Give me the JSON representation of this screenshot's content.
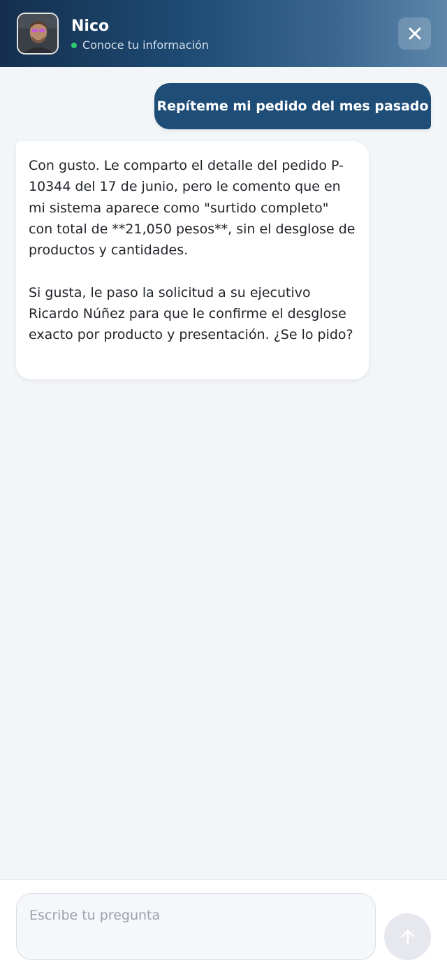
{
  "header": {
    "agent_name": "Nico",
    "status_text": "Conoce tu información",
    "status_color": "#2ecc71",
    "close_icon": "close-icon"
  },
  "messages": [
    {
      "role": "user",
      "text": "Repíteme mi pedido del mes pasado"
    },
    {
      "role": "assistant",
      "text": "Con gusto. Le comparto el detalle del pedido P-10344 del 17 de junio, pero le comento que en mi sistema aparece como \"surtido completo\" con total de **21,050 pesos**, sin el desglose de productos y cantidades.\n\nSi gusta, le paso la solicitud a su ejecutivo Ricardo Núñez para que le confirme el desglose exacto por producto y presentación. ¿Se lo pido?"
    }
  ],
  "composer": {
    "placeholder": "Escribe tu pregunta",
    "value": "",
    "send_icon": "arrow-up-icon"
  },
  "colors": {
    "user_bubble": "#1e4d78",
    "header_start": "#152f4d",
    "header_end": "#5d86aa",
    "background": "#f3f6f9"
  }
}
